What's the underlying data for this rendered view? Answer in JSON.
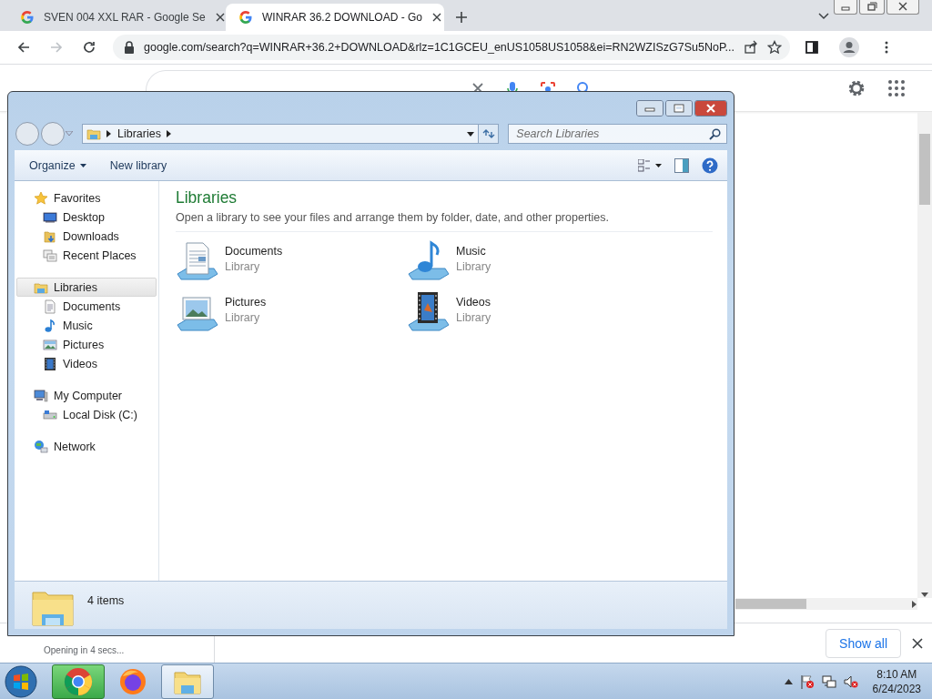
{
  "browser": {
    "tabs": [
      {
        "title": "SVEN 004 XXL RAR - Google Se",
        "selected": false
      },
      {
        "title": "WINRAR 36.2 DOWNLOAD - Go",
        "selected": true
      }
    ],
    "url": "google.com/search?q=WINRAR+36.2+DOWNLOAD&rlz=1C1GCEU_enUS1058US1058&ei=RN2WZISzG7Su5NoP...",
    "download": {
      "status": "Opening in 4 secs...",
      "show_all": "Show all"
    }
  },
  "explorer": {
    "path": [
      "Libraries"
    ],
    "search_placeholder": "Search Libraries",
    "commands": [
      {
        "label": "Organize",
        "menu": true
      },
      {
        "label": "New library",
        "menu": false
      }
    ],
    "nav": [
      {
        "label": "Favorites",
        "kind": "star",
        "selected": false,
        "children": [
          {
            "label": "Desktop",
            "kind": "desktop",
            "selected": false
          },
          {
            "label": "Downloads",
            "kind": "downloads",
            "selected": false
          },
          {
            "label": "Recent Places",
            "kind": "recent",
            "selected": false
          }
        ]
      },
      {
        "label": "Libraries",
        "kind": "libraries",
        "selected": true,
        "children": [
          {
            "label": "Documents",
            "kind": "documents",
            "selected": false
          },
          {
            "label": "Music",
            "kind": "music",
            "selected": false
          },
          {
            "label": "Pictures",
            "kind": "pictures",
            "selected": false
          },
          {
            "label": "Videos",
            "kind": "videos",
            "selected": false
          }
        ]
      },
      {
        "label": "My Computer",
        "kind": "computer",
        "selected": false,
        "children": [
          {
            "label": "Local Disk (C:)",
            "kind": "disk",
            "selected": false
          }
        ]
      },
      {
        "label": "Network",
        "kind": "network",
        "selected": false
      }
    ],
    "heading": "Libraries",
    "description": "Open a library to see your files and arrange them by folder, date, and other properties.",
    "libraries": [
      {
        "name": "Documents",
        "type": "Library",
        "kind": "documents"
      },
      {
        "name": "Music",
        "type": "Library",
        "kind": "music"
      },
      {
        "name": "Pictures",
        "type": "Library",
        "kind": "pictures"
      },
      {
        "name": "Videos",
        "type": "Library",
        "kind": "videos"
      }
    ],
    "status": "4 items"
  },
  "taskbar": {
    "apps": [
      {
        "kind": "chrome",
        "flashing": true,
        "active": false
      },
      {
        "kind": "firefox",
        "flashing": false,
        "active": false
      },
      {
        "kind": "explorer",
        "flashing": false,
        "active": true
      }
    ],
    "time": "8:10 AM",
    "date": "6/24/2023"
  }
}
